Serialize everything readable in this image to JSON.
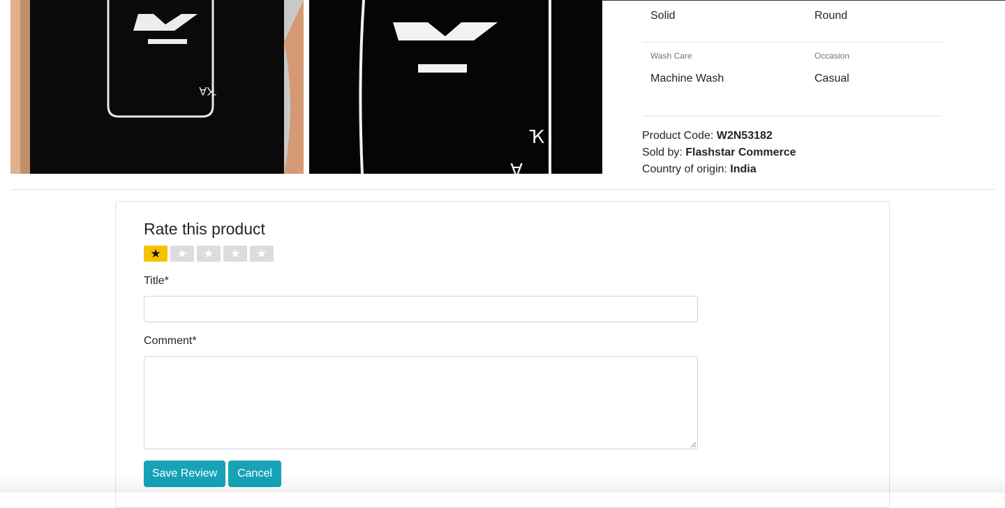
{
  "specs": [
    {
      "label": "",
      "value": "Solid"
    },
    {
      "label": "",
      "value": "Round"
    },
    {
      "label": "Wash Care",
      "value": "Machine Wash"
    },
    {
      "label": "Occasion",
      "value": "Casual"
    }
  ],
  "product_meta": {
    "code_label": "Product Code:",
    "code_value": "W2N53182",
    "seller_label": "Sold by:",
    "seller_value": "Flashstar Commerce",
    "origin_label": "Country of origin:",
    "origin_value": "India"
  },
  "review_form": {
    "heading": "Rate this product",
    "rating": 1,
    "max_rating": 5,
    "star_glyph": "★",
    "title_label": "Title*",
    "title_value": "",
    "comment_label": "Comment*",
    "comment_value": "",
    "save_label": "Save Review",
    "cancel_label": "Cancel"
  },
  "colors": {
    "accent": "#17a2b8",
    "star_active": "#f5c200",
    "star_inactive": "#dcdcdc"
  }
}
